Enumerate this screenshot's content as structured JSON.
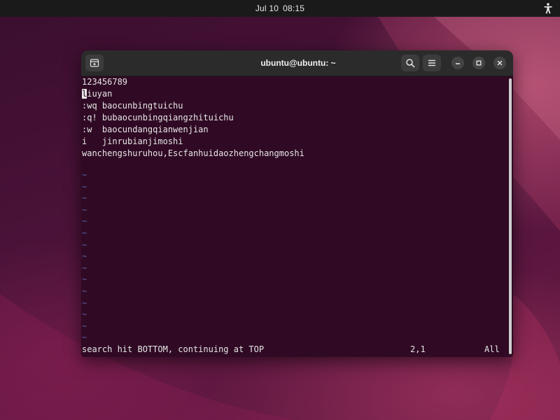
{
  "topbar": {
    "date": "Jul 10",
    "time": "08:15",
    "accessibility_icon": "accessibility-icon"
  },
  "window": {
    "title": "ubuntu@ubuntu: ~",
    "buttons": {
      "new_tab_icon": "new-tab-icon",
      "search_icon": "search-icon",
      "menu_icon": "hamburger-menu-icon",
      "minimize_icon": "minimize-icon",
      "maximize_icon": "maximize-icon",
      "close_icon": "close-icon"
    }
  },
  "terminal": {
    "lines": [
      "123456789",
      "liuyan",
      ":wq baocunbingtuichu",
      ":q! bubaocunbingqiangzhituichu",
      ":w  baocundangqianwenjian",
      "i   jinrubianjimoshi",
      "wanchengshuruhou,Escfanhuidaozhengchangmoshi"
    ],
    "cursor_char": "l",
    "cursor_rest": "iuyan",
    "tilde_char": "~",
    "empty_line_count": 15,
    "status_message": "search hit BOTTOM, continuing at TOP",
    "cursor_position": "2,1",
    "scroll_percent": "All"
  },
  "colors": {
    "terminal_bg": "#300a24",
    "terminal_fg": "#e6e6e6",
    "tilde": "#5a5fa8",
    "headerbar": "#2b2b2b",
    "topbar": "#1a1a1a"
  }
}
